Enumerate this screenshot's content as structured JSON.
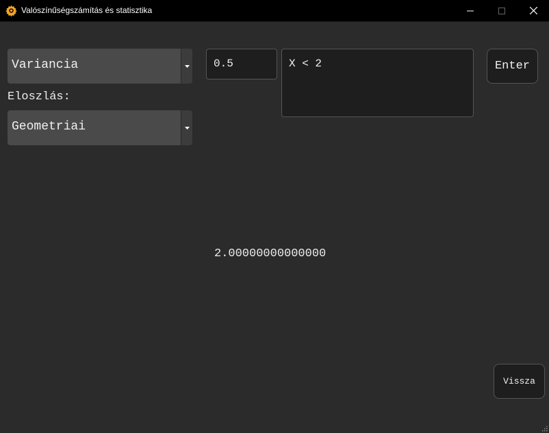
{
  "window": {
    "title": "Valószínűségszámítás és statisztika",
    "icon": "gear-icon",
    "accent_color": "#f5a623"
  },
  "controls": {
    "mode_combo": {
      "value": "Variancia"
    },
    "distribution_label": "Eloszlás:",
    "distribution_combo": {
      "value": "Geometriai"
    },
    "parameter_input": {
      "value": "0.5"
    },
    "expression_input": {
      "value": "X < 2"
    },
    "enter_button": "Enter",
    "back_button": "Vissza"
  },
  "result": {
    "value": "2.00000000000000"
  }
}
